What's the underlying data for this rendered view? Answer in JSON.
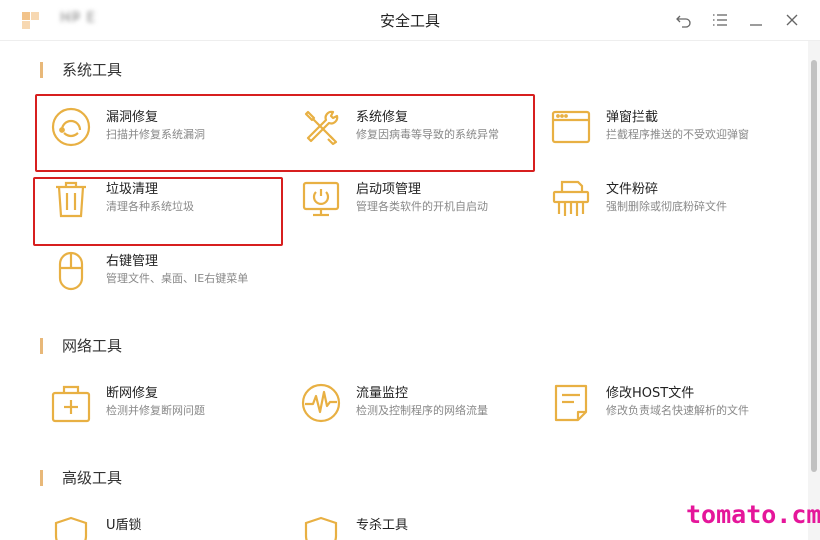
{
  "window": {
    "app_name": "H̵P̵ E",
    "title": "安全工具",
    "controls": [
      "back",
      "menu",
      "minimize",
      "close"
    ]
  },
  "sections": [
    {
      "title": "系统工具",
      "tools": [
        {
          "name": "漏洞修复",
          "desc": "扫描并修复系统漏洞",
          "icon": "shield-scan-icon"
        },
        {
          "name": "系统修复",
          "desc": "修复因病毒等导致的系统异常",
          "icon": "wrench-screwdriver-icon"
        },
        {
          "name": "弹窗拦截",
          "desc": "拦截程序推送的不受欢迎弹窗",
          "icon": "window-icon"
        },
        {
          "name": "垃圾清理",
          "desc": "清理各种系统垃圾",
          "icon": "trash-icon"
        },
        {
          "name": "启动项管理",
          "desc": "管理各类软件的开机自启动",
          "icon": "monitor-power-icon"
        },
        {
          "name": "文件粉碎",
          "desc": "强制删除或彻底粉碎文件",
          "icon": "shredder-icon"
        },
        {
          "name": "右键管理",
          "desc": "管理文件、桌面、IE右键菜单",
          "icon": "mouse-icon"
        }
      ]
    },
    {
      "title": "网络工具",
      "tools": [
        {
          "name": "断网修复",
          "desc": "检测并修复断网问题",
          "icon": "first-aid-icon"
        },
        {
          "name": "流量监控",
          "desc": "检测及控制程序的网络流量",
          "icon": "pulse-icon"
        },
        {
          "name": "修改HOST文件",
          "desc": "修改负责域名快速解析的文件",
          "icon": "document-icon"
        }
      ]
    },
    {
      "title": "高级工具",
      "tools": [
        {
          "name": "U盾锁",
          "desc": "",
          "icon": "shield-icon"
        },
        {
          "name": "专杀工具",
          "desc": "",
          "icon": "shield-icon"
        }
      ]
    }
  ],
  "watermark": "tomato.cm",
  "colors": {
    "accent": "#e8b043",
    "highlight": "#d71f1f",
    "watermark": "#e5169a"
  }
}
